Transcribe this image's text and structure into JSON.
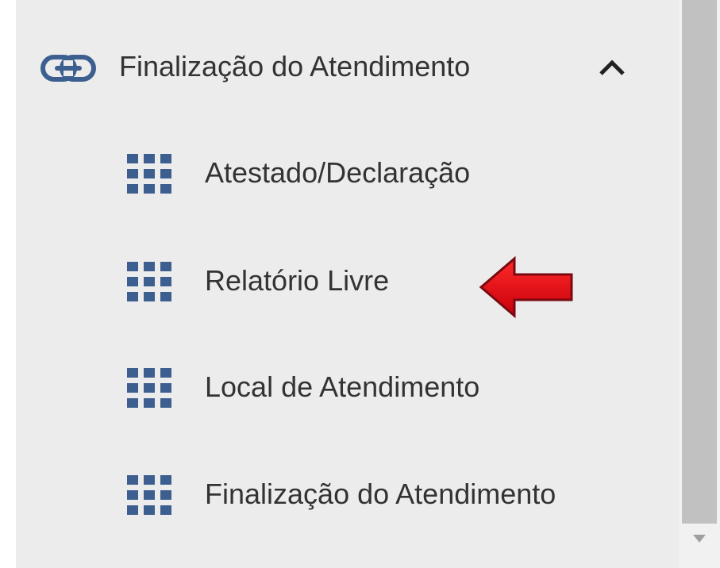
{
  "menu": {
    "header_label": "Finalização do Atendimento",
    "header_icon": "link-icon",
    "expand_icon": "chevron-up-icon",
    "items": [
      {
        "label": "Atestado/Declaração",
        "icon": "apps-grid-icon"
      },
      {
        "label": "Relatório Livre",
        "icon": "apps-grid-icon"
      },
      {
        "label": "Local de Atendimento",
        "icon": "apps-grid-icon"
      },
      {
        "label": "Finalização do Atendimento",
        "icon": "apps-grid-icon"
      }
    ]
  },
  "annotation": {
    "arrow_icon": "red-arrow-left-icon",
    "arrow_color": "#e0101a"
  },
  "colors": {
    "icon_blue": "#3d5f8f",
    "text": "#333333",
    "panel_bg": "#ececec"
  }
}
